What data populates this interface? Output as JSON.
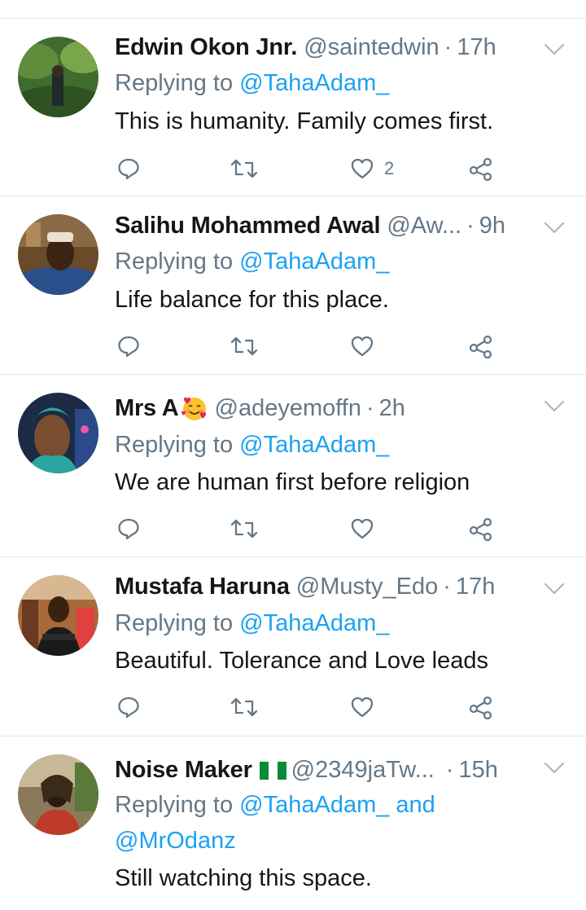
{
  "replying_prefix": "Replying to",
  "tweets": [
    {
      "name": "Edwin Okon Jnr.",
      "handle": "@saintedwin",
      "time": "17h",
      "reply_to": "@TahaAdam_",
      "text": "This is humanity. Family comes first.",
      "likes": "2",
      "avatar": "avatar-edwin"
    },
    {
      "name": "Salihu Mohammed Awal",
      "handle": "@Aw...",
      "time": "9h",
      "reply_to": "@TahaAdam_",
      "text": "Life balance for this place.",
      "likes": "",
      "avatar": "avatar-salihu"
    },
    {
      "name": "Mrs A",
      "handle": "@adeyemoffn",
      "time": "2h",
      "reply_to": "@TahaAdam_",
      "text": "We are human first before religion",
      "likes": "",
      "avatar": "avatar-mrsa",
      "name_emoji": "smiling-face-with-hearts-emoji"
    },
    {
      "name": "Mustafa Haruna",
      "handle": "@Musty_Edo",
      "time": "17h",
      "reply_to": "@TahaAdam_",
      "text": "Beautiful. Tolerance and Love leads",
      "likes": "",
      "avatar": "avatar-mustafa"
    },
    {
      "name": "Noise Maker",
      "handle": "@2349jaTw...",
      "time": "15h",
      "reply_to": "@TahaAdam_ and",
      "reply_to_2": "@MrOdanz",
      "text": "Still watching this space.",
      "avatar": "avatar-noisemaker",
      "name_flag": "nigeria-flag-emoji"
    }
  ],
  "colors": {
    "link": "#1da1f2",
    "muted": "#657786",
    "text": "#14171a",
    "divider": "#e1e8ed"
  }
}
